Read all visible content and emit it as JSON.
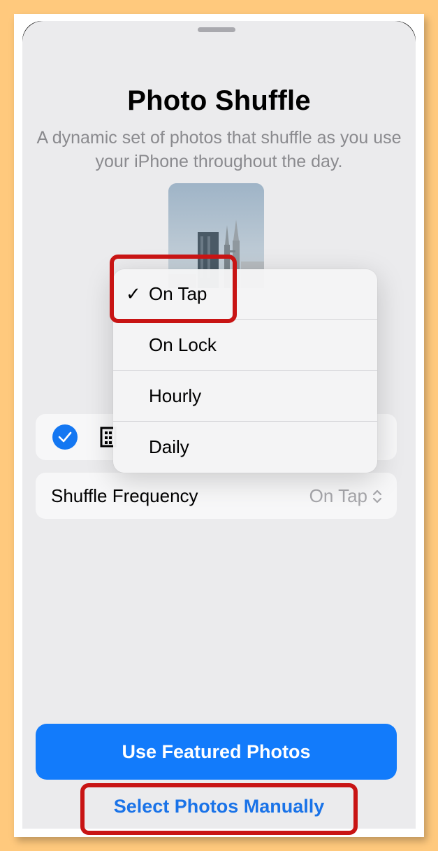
{
  "sheet": {
    "title": "Photo Shuffle",
    "subtitle": "A dynamic set of photos that shuffle as you use your iPhone throughout the day."
  },
  "album_row": {
    "checked": true,
    "icon": "building-icon"
  },
  "shuffle_row": {
    "label": "Shuffle Frequency",
    "value": "On Tap",
    "icon": "chevron-up-down-icon"
  },
  "menu": {
    "items": [
      {
        "label": "On Tap",
        "checked": true,
        "check_mark": "✓"
      },
      {
        "label": "On Lock",
        "checked": false
      },
      {
        "label": "Hourly",
        "checked": false
      },
      {
        "label": "Daily",
        "checked": false
      }
    ]
  },
  "buttons": {
    "primary": "Use Featured Photos",
    "secondary": "Select Photos Manually"
  },
  "colors": {
    "accent": "#127bfb",
    "highlight": "#c81414",
    "background": "#ffc97d"
  }
}
